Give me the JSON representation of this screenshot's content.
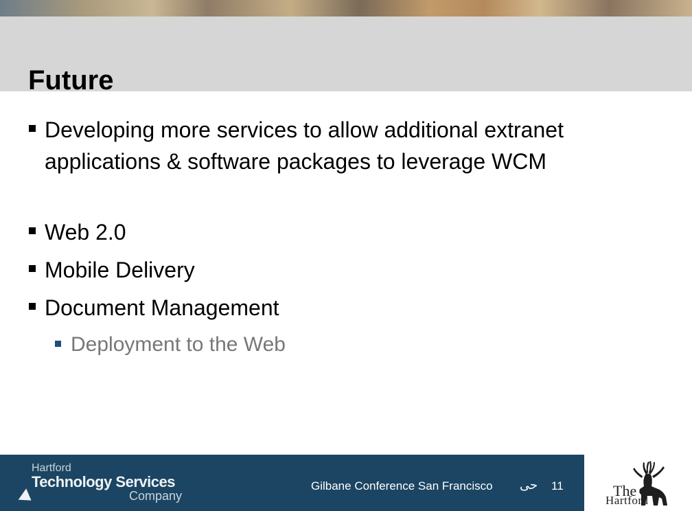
{
  "slide": {
    "title": "Future",
    "bullets": [
      {
        "level": 1,
        "text": "Developing more services to allow additional extranet applications & software packages to leverage WCM"
      },
      {
        "level": 1,
        "text": "Web 2.0"
      },
      {
        "level": 1,
        "text": "Mobile Delivery"
      },
      {
        "level": 1,
        "text": "Document Management"
      },
      {
        "level": 2,
        "text": "Deployment to the Web"
      }
    ]
  },
  "footer": {
    "logo_line1": "Hartford",
    "logo_line2": "Technology Services",
    "logo_line3": "Company",
    "conference": "Gilbane Conference San Francisco",
    "glyph": "حى",
    "page_number": "11"
  },
  "hartford_logo": {
    "line1": "The",
    "line2": "Hartford"
  },
  "colors": {
    "footer_bar": "#1b4562",
    "header_band": "#d6d6d6",
    "subbullet_text": "#777777",
    "subbullet_marker": "#1d4f7a"
  }
}
